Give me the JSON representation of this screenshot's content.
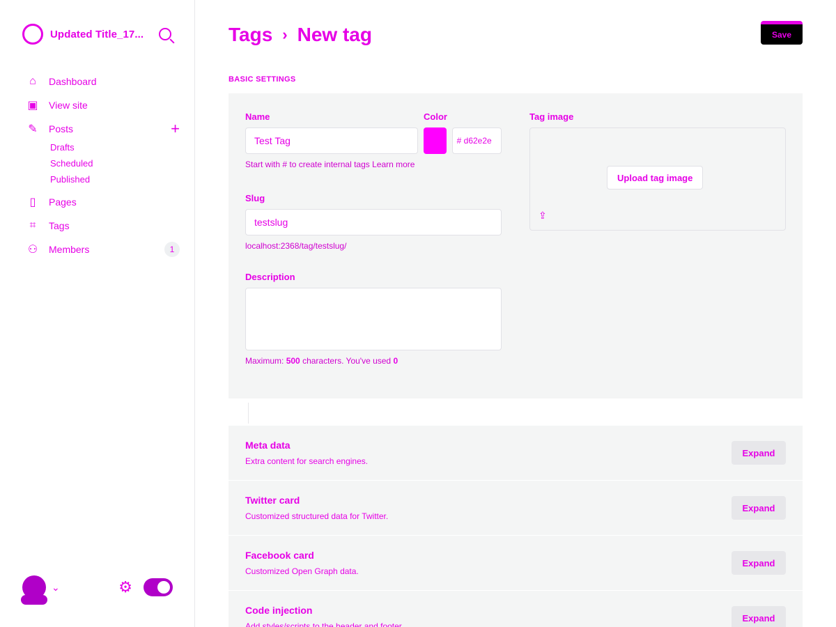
{
  "sidebar": {
    "site_title": "Updated Title_17...",
    "nav": [
      {
        "label": "Dashboard",
        "icon": "home-icon"
      },
      {
        "label": "View site",
        "icon": "browser-icon"
      }
    ],
    "posts": {
      "label": "Posts",
      "sub": [
        "Drafts",
        "Scheduled",
        "Published"
      ]
    },
    "pages_label": "Pages",
    "tags_label": "Tags",
    "members_label": "Members",
    "members_count": "1"
  },
  "header": {
    "breadcrumb_root": "Tags",
    "breadcrumb_current": "New tag",
    "save_label": "Save"
  },
  "basic_settings": {
    "section_title": "BASIC SETTINGS",
    "name_label": "Name",
    "name_value": "Test Tag",
    "name_hint": "Start with # to create internal tags Learn more",
    "color_label": "Color",
    "color_hex": "# d62e2e",
    "slug_label": "Slug",
    "slug_value": "testslug",
    "slug_url": "localhost:2368/tag/testslug/",
    "description_label": "Description",
    "description_hint_prefix": "Maximum:",
    "description_max": "500",
    "description_hint_mid": "characters. You've used",
    "description_used": "0",
    "tag_image_label": "Tag image",
    "upload_label": "Upload tag image"
  },
  "accordion": [
    {
      "title": "Meta data",
      "desc": "Extra content for search engines.",
      "expand": "Expand"
    },
    {
      "title": "Twitter card",
      "desc": "Customized structured data for Twitter.",
      "expand": "Expand"
    },
    {
      "title": "Facebook card",
      "desc": "Customized Open Graph data.",
      "expand": "Expand"
    },
    {
      "title": "Code injection",
      "desc": "Add styles/scripts to the header and footer",
      "expand": "Expand"
    }
  ],
  "colors": {
    "accent": "#e600e6",
    "swatch": "#ff00ff"
  }
}
